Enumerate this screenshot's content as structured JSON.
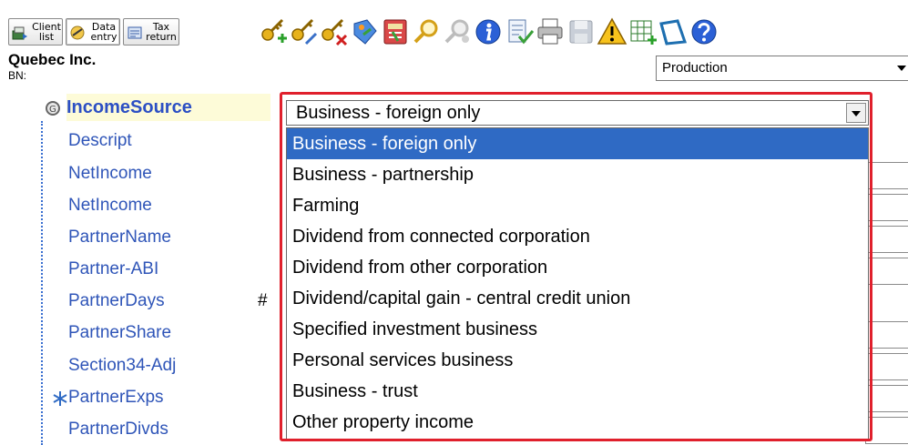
{
  "toolbar": {
    "tabs": [
      {
        "name": "client-list",
        "line1": "Client",
        "line2": "list"
      },
      {
        "name": "data-entry",
        "line1": "Data",
        "line2": "entry"
      },
      {
        "name": "tax-return",
        "line1": "Tax",
        "line2": "return"
      }
    ],
    "icons": [
      "add-key-icon",
      "edit-key-icon",
      "delete-key-icon",
      "tag-icon",
      "calculator-icon",
      "search-icon",
      "search-person-icon",
      "info-icon",
      "checklist-icon",
      "print-icon",
      "save-icon",
      "warning-icon",
      "grid-add-icon",
      "window-icon",
      "help-icon"
    ]
  },
  "header": {
    "company": "Quebec Inc.",
    "bn_label": "BN:",
    "mode": "Production"
  },
  "form": {
    "active_field": "IncomeSource",
    "fields": [
      "Descript",
      "NetIncome",
      "NetIncome",
      "PartnerName",
      "Partner-ABI",
      "PartnerDays",
      "PartnerShare",
      "Section34-Adj",
      "PartnerExps",
      "PartnerDivds"
    ],
    "hash_marker": "#"
  },
  "dropdown": {
    "value": "Business - foreign only",
    "options": [
      "Business - foreign only",
      "Business - partnership",
      "Farming",
      "Dividend from connected corporation",
      "Dividend from other corporation",
      "Dividend/capital gain - central credit union",
      "Specified investment business",
      "Personal services business",
      "Business - trust",
      "Other property income"
    ],
    "selected_index": 0
  },
  "colors": {
    "highlight": "#2f6ac4",
    "label": "#2f55b8",
    "annotation": "#e0202c"
  }
}
